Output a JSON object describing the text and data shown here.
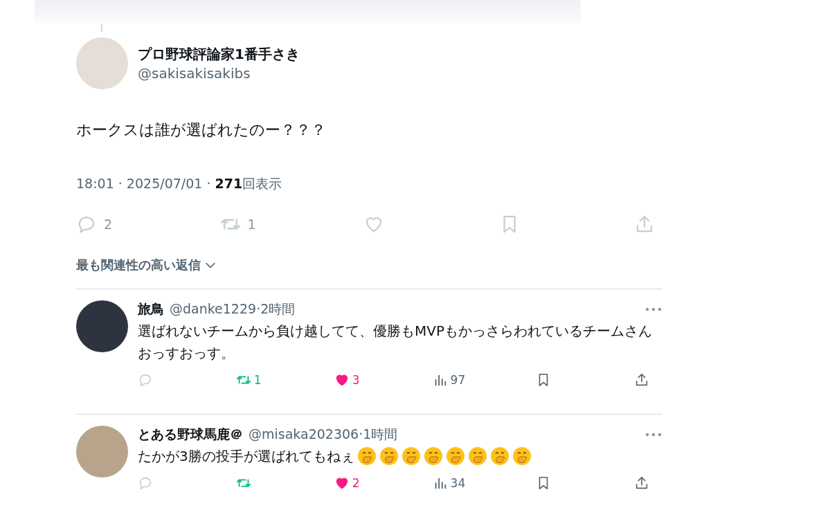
{
  "post": {
    "author": {
      "name": "プロ野球評論家1番手さき",
      "handle": "@sakisakisakibs"
    },
    "text": "ホークスは誰が選ばれたのー？？？",
    "meta": "18:01 · 2025/07/01 · **271**回表示",
    "actions": [
      {
        "kind": "reply",
        "count": "2",
        "active": false,
        "dimmed": true
      },
      {
        "kind": "repost",
        "count": "1",
        "active": false,
        "dimmed": true
      },
      {
        "kind": "like",
        "active": false,
        "dimmed": true
      },
      {
        "kind": "bookmark",
        "dimmed": true
      },
      {
        "kind": "share",
        "dimmed": true
      }
    ]
  },
  "sort": {
    "label": "最も関連性の高い返信"
  },
  "replies": [
    {
      "name": "旅鳥",
      "handle": "@danke1229",
      "time": "·2時間",
      "text": "選ばれないチームから負け越してて、優勝もMVPもかっさらわれているチームさんおっすおっす。",
      "actions": [
        {
          "kind": "reply",
          "active": false,
          "dimmed": true
        },
        {
          "kind": "repost",
          "count": "1",
          "active": true
        },
        {
          "kind": "like",
          "count": "3",
          "active": true
        },
        {
          "kind": "views",
          "count": "97",
          "dimmed": false
        },
        {
          "kind": "bookmark",
          "dimmed": false
        },
        {
          "kind": "share",
          "dimmed": false
        }
      ]
    },
    {
      "name": "とある野球馬鹿＠",
      "handle": "@misaka202306",
      "time": "·1時間",
      "text": "たかが3勝の投手が選ばれてもねぇ",
      "reactions": [
        {
          "kind": "hand-over-mouth"
        },
        {
          "kind": "hand-over-mouth"
        },
        {
          "kind": "hand-over-mouth"
        },
        {
          "kind": "hand-over-mouth"
        },
        {
          "kind": "hand-over-mouth"
        },
        {
          "kind": "hand-over-mouth"
        },
        {
          "kind": "hand-over-mouth"
        },
        {
          "kind": "hand-over-mouth"
        }
      ],
      "actions": [
        {
          "kind": "reply",
          "active": false,
          "dimmed": true
        },
        {
          "kind": "repost",
          "active": true
        },
        {
          "kind": "like",
          "count": "2",
          "active": true
        },
        {
          "kind": "views",
          "count": "34",
          "dimmed": false
        },
        {
          "kind": "bookmark",
          "dimmed": false
        },
        {
          "kind": "share",
          "dimmed": false
        }
      ]
    }
  ]
}
